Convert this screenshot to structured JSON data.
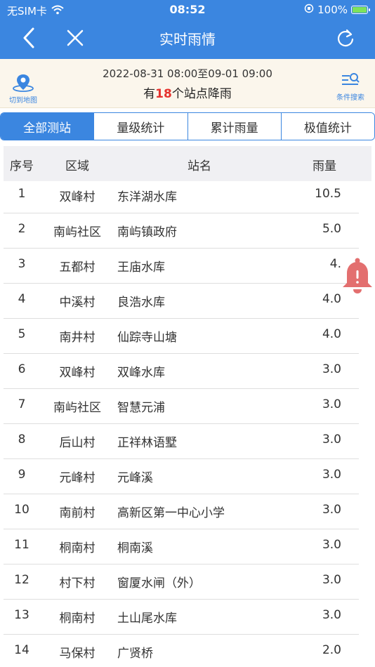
{
  "status_bar": {
    "carrier": "无SIM卡",
    "time": "08:52",
    "battery": "100%"
  },
  "nav": {
    "title": "实时雨情"
  },
  "info": {
    "map_label": "切到地图",
    "date_range": "2022-08-31 08:00至09-01 09:00",
    "summary_prefix": "有",
    "summary_count": "18",
    "summary_suffix": "个站点降雨",
    "search_label": "条件搜索"
  },
  "tabs": [
    {
      "label": "全部测站",
      "active": true
    },
    {
      "label": "量级统计",
      "active": false
    },
    {
      "label": "累计雨量",
      "active": false
    },
    {
      "label": "极值统计",
      "active": false
    }
  ],
  "table": {
    "headers": {
      "no": "序号",
      "area": "区域",
      "station": "站名",
      "rain": "雨量"
    },
    "rows": [
      {
        "no": "1",
        "area": "双峰村",
        "station": "东洋湖水库",
        "rain": "10.5"
      },
      {
        "no": "2",
        "area": "南屿社区",
        "station": "南屿镇政府",
        "rain": "5.0"
      },
      {
        "no": "3",
        "area": "五都村",
        "station": "王庙水库",
        "rain": "4."
      },
      {
        "no": "4",
        "area": "中溪村",
        "station": "良浩水库",
        "rain": "4.0"
      },
      {
        "no": "5",
        "area": "南井村",
        "station": "仙踪寺山塘",
        "rain": "4.0"
      },
      {
        "no": "6",
        "area": "双峰村",
        "station": "双峰水库",
        "rain": "3.0"
      },
      {
        "no": "7",
        "area": "南屿社区",
        "station": "智慧元浦",
        "rain": "3.0"
      },
      {
        "no": "8",
        "area": "后山村",
        "station": "正祥林语墅",
        "rain": "3.0"
      },
      {
        "no": "9",
        "area": "元峰村",
        "station": "元峰溪",
        "rain": "3.0"
      },
      {
        "no": "10",
        "area": "南前村",
        "station": "高新区第一中心小学",
        "rain": "3.0"
      },
      {
        "no": "11",
        "area": "桐南村",
        "station": "桐南溪",
        "rain": "3.0"
      },
      {
        "no": "12",
        "area": "村下村",
        "station": "窗厦水闸（外）",
        "rain": "3.0"
      },
      {
        "no": "13",
        "area": "桐南村",
        "station": "土山尾水库",
        "rain": "3.0"
      },
      {
        "no": "14",
        "area": "马保村",
        "station": "广贤桥",
        "rain": "2.0"
      }
    ]
  }
}
